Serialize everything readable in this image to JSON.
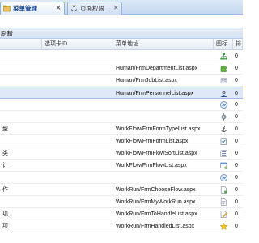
{
  "tabs": [
    {
      "label": "菜单管理",
      "icon": "menu-folder-icon",
      "active": true
    },
    {
      "label": "页面权限",
      "icon": "anchor-icon",
      "active": false
    }
  ],
  "toolbar": {
    "refresh_label": "刷新"
  },
  "grid": {
    "columns": [
      "",
      "选项卡ID",
      "菜单地址",
      "图标",
      "排"
    ],
    "rows": [
      {
        "name": "",
        "tab_id": "",
        "url": "",
        "icon": "sitemap-icon",
        "order": "0",
        "selected": false
      },
      {
        "name": "",
        "tab_id": "",
        "url": "Human/FrmDepartmentList.aspx",
        "icon": "puzzle-icon",
        "order": "0",
        "selected": false
      },
      {
        "name": "",
        "tab_id": "",
        "url": "Human/FrmJobList.aspx",
        "icon": "badge-icon",
        "order": "0",
        "selected": false
      },
      {
        "name": "",
        "tab_id": "",
        "url": "Human/FrmPersonnelList.aspx",
        "icon": "user-icon",
        "order": "0",
        "selected": true
      },
      {
        "name": "",
        "tab_id": "",
        "url": "",
        "icon": "forward-icon",
        "order": "0",
        "selected": false
      },
      {
        "name": "",
        "tab_id": "",
        "url": "",
        "icon": "gear-icon",
        "order": "0",
        "selected": false
      },
      {
        "name": "型",
        "tab_id": "",
        "url": "WorkFlow/FrmFormTypeList.aspx",
        "icon": "anchor-icon",
        "order": "0",
        "selected": false
      },
      {
        "name": "",
        "tab_id": "",
        "url": "WorkFlow/FrmFormList.aspx",
        "icon": "form-check-icon",
        "order": "0",
        "selected": false
      },
      {
        "name": "类",
        "tab_id": "",
        "url": "WorkFlow/FrmFlowSortList.aspx",
        "icon": "list-icon",
        "order": "0",
        "selected": false
      },
      {
        "name": "计",
        "tab_id": "",
        "url": "WorkFlow/FrmFlowList.aspx",
        "icon": "window-icon",
        "order": "0",
        "selected": false
      },
      {
        "name": "",
        "tab_id": "",
        "url": "",
        "icon": "forward-icon",
        "order": "0",
        "selected": false
      },
      {
        "name": "作",
        "tab_id": "",
        "url": "WorkRun/FrmChooseFlow.aspx",
        "icon": "new-page-icon",
        "order": "0",
        "selected": false
      },
      {
        "name": "",
        "tab_id": "",
        "url": "WorkRun/FrmMyWorkRun.aspx",
        "icon": "document-icon",
        "order": "0",
        "selected": false
      },
      {
        "name": "项",
        "tab_id": "",
        "url": "WorkRun/FrmToHandleList.aspx",
        "icon": "edit-page-icon",
        "order": "0",
        "selected": false
      },
      {
        "name": "项",
        "tab_id": "",
        "url": "WorkRun/FrmHandledList.aspx",
        "icon": "star-icon",
        "order": "0",
        "selected": false
      }
    ]
  },
  "colors": {
    "tab_text": "#15428b",
    "selected_row": "#dfe8f6",
    "header_border": "#99bbe8"
  }
}
